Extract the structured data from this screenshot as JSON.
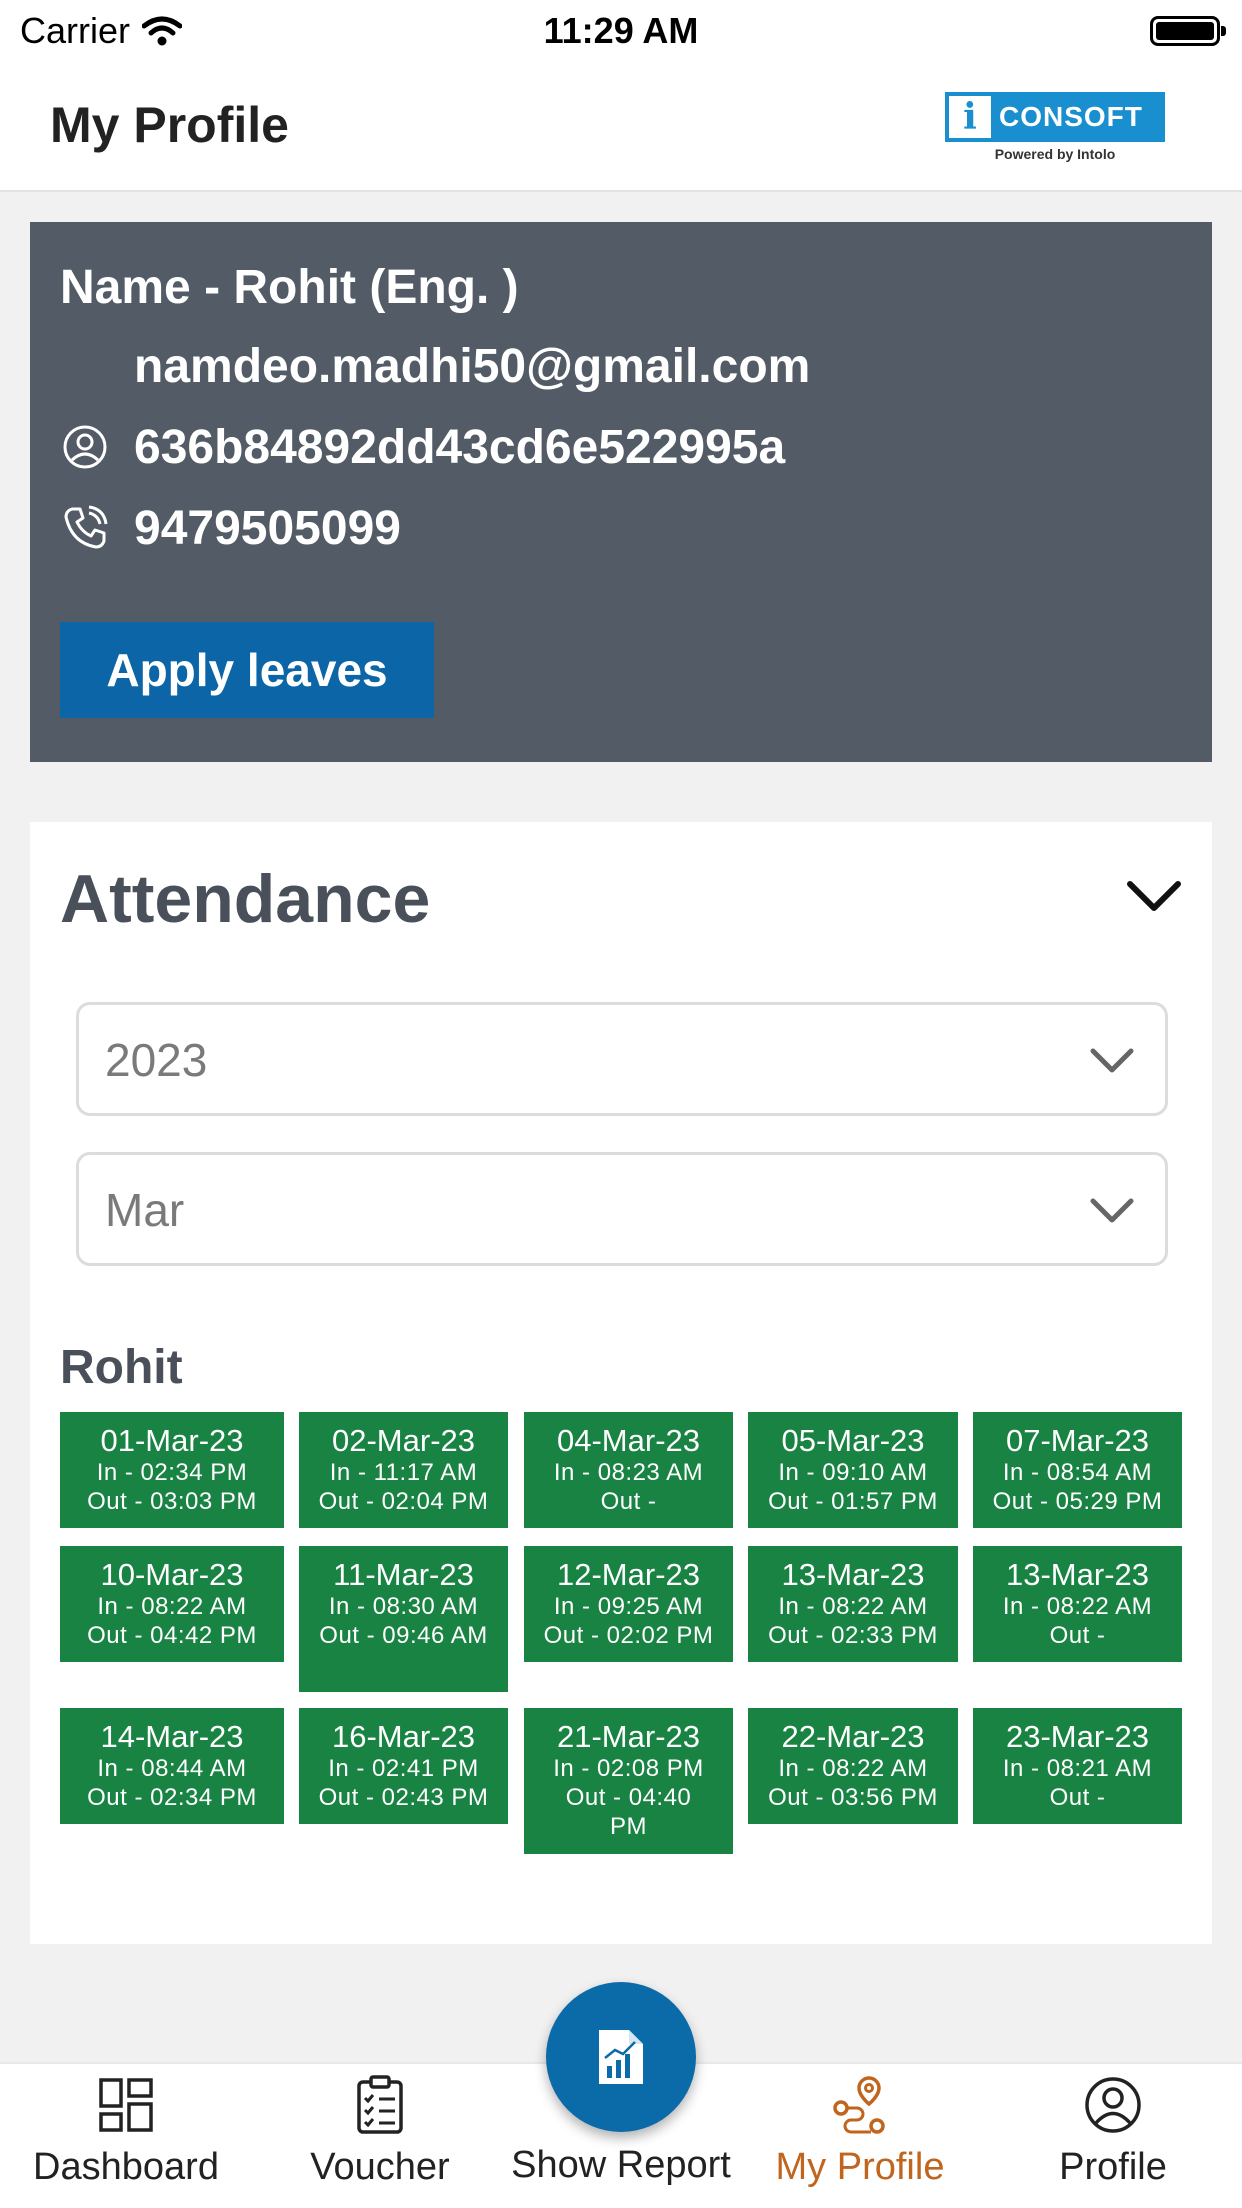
{
  "status_bar": {
    "carrier": "Carrier",
    "time": "11:29 AM"
  },
  "header": {
    "title": "My Profile",
    "logo_text": "CONSOFT",
    "logo_sub": "Powered by Intolo"
  },
  "profile": {
    "name": "Name - Rohit (Eng. )",
    "email": "namdeo.madhi50@gmail.com",
    "user_id": "636b84892dd43cd6e522995a",
    "phone": "9479505099",
    "apply_label": "Apply leaves"
  },
  "attendance": {
    "heading": "Attendance",
    "year": "2023",
    "month": "Mar",
    "person": "Rohit",
    "records": [
      {
        "date": "01-Mar-23",
        "in": "In - 02:34 PM",
        "out": "Out - 03:03 PM"
      },
      {
        "date": "02-Mar-23",
        "in": "In - 11:17 AM",
        "out": "Out - 02:04 PM"
      },
      {
        "date": "04-Mar-23",
        "in": "In - 08:23 AM",
        "out": "Out -"
      },
      {
        "date": "05-Mar-23",
        "in": "In - 09:10 AM",
        "out": "Out - 01:57 PM"
      },
      {
        "date": "07-Mar-23",
        "in": "In - 08:54 AM",
        "out": "Out - 05:29 PM"
      },
      {
        "date": "10-Mar-23",
        "in": "In - 08:22 AM",
        "out": "Out - 04:42 PM"
      },
      {
        "date": "11-Mar-23",
        "in": "In - 08:30 AM",
        "out": "Out - 09:46 AM"
      },
      {
        "date": "12-Mar-23",
        "in": "In - 09:25 AM",
        "out": "Out - 02:02 PM"
      },
      {
        "date": "13-Mar-23",
        "in": "In - 08:22 AM",
        "out": "Out - 02:33 PM"
      },
      {
        "date": "13-Mar-23",
        "in": "In - 08:22 AM",
        "out": "Out -"
      },
      {
        "date": "14-Mar-23",
        "in": "In - 08:44 AM",
        "out": "Out - 02:34 PM"
      },
      {
        "date": "16-Mar-23",
        "in": "In - 02:41 PM",
        "out": "Out - 02:43 PM"
      },
      {
        "date": "21-Mar-23",
        "in": "In - 02:08 PM",
        "out": "Out - 04:40 PM"
      },
      {
        "date": "22-Mar-23",
        "in": "In - 08:22 AM",
        "out": "Out - 03:56 PM"
      },
      {
        "date": "23-Mar-23",
        "in": "In - 08:21 AM",
        "out": "Out -"
      }
    ]
  },
  "nav": {
    "dashboard": "Dashboard",
    "voucher": "Voucher",
    "show_report": "Show Report",
    "my_profile": "My Profile",
    "profile": "Profile",
    "active_color": "#c0641e"
  },
  "colors": {
    "card": "#525b66",
    "accent": "#0b65a7",
    "tile": "#198343"
  }
}
